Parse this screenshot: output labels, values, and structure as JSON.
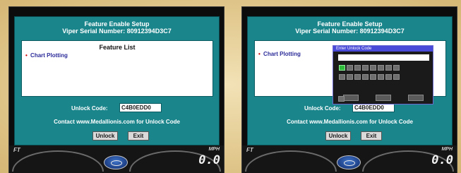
{
  "screens": [
    {
      "dialog": {
        "title": "Feature Enable Setup",
        "serial": "Viper Serial Number: 80912394D3C7",
        "feature_list_heading": "Feature List",
        "features": [
          "Chart Plotting"
        ],
        "unlock_code_label": "Unlock Code:",
        "unlock_code_value": "C4B0EDD0",
        "contact_text": "Contact www.Medallionis.com for Unlock Code",
        "unlock_button": "Unlock",
        "exit_button": "Exit"
      },
      "gauges": {
        "left_unit": "FT",
        "right_unit": "MPH",
        "speed_value": "0.0"
      }
    },
    {
      "dialog": {
        "title": "Feature Enable Setup",
        "serial": "Viper Serial Number: 80912394D3C7",
        "features": [
          "Chart Plotting"
        ],
        "unlock_code_label": "Unlock Code:",
        "unlock_code_value": "C4B0EDD0",
        "contact_text": "Contact www.Medallionis.com for Unlock Code",
        "unlock_button": "Unlock",
        "exit_button": "Exit"
      },
      "keypad": {
        "title": "Enter Unlock Code",
        "key_rows": 2,
        "keys_per_row": 8,
        "active_key_index": 0,
        "bottom_buttons": 3
      },
      "gauges": {
        "left_unit": "FT",
        "right_unit": "MPH",
        "speed_value": "0.0"
      }
    }
  ],
  "colors": {
    "dialog_teal": "#1b858c",
    "keypad_title_blue": "#4a4ad8",
    "active_key_green": "#2dbb39",
    "background_gold": "#e2c98f"
  },
  "icons": [
    "ford-logo-icon"
  ]
}
